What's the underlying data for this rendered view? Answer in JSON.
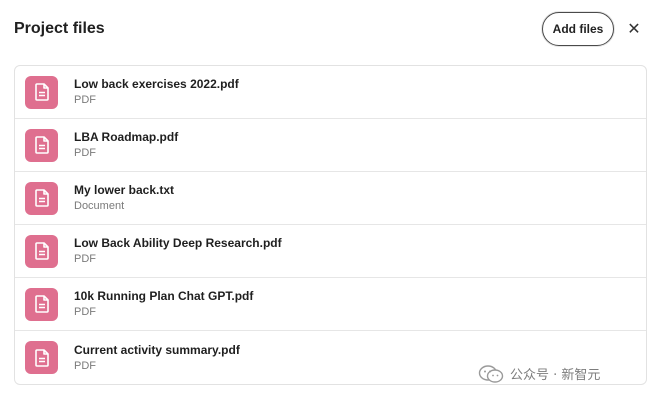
{
  "header": {
    "title": "Project files",
    "add_files_label": "Add files",
    "close_glyph": "✕"
  },
  "files": [
    {
      "name": "Low back exercises 2022.pdf",
      "type": "PDF"
    },
    {
      "name": "LBA Roadmap.pdf",
      "type": "PDF"
    },
    {
      "name": "My lower back.txt",
      "type": "Document"
    },
    {
      "name": "Low Back Ability Deep Research.pdf",
      "type": "PDF"
    },
    {
      "name": "10k Running Plan Chat GPT.pdf",
      "type": "PDF"
    },
    {
      "name": "Current activity summary.pdf",
      "type": "PDF"
    }
  ],
  "file_icon": {
    "name": "document-icon",
    "color": "#df6f8f"
  },
  "watermark": {
    "text": "公众号 · 新智元",
    "icon": "wechat-icon"
  }
}
